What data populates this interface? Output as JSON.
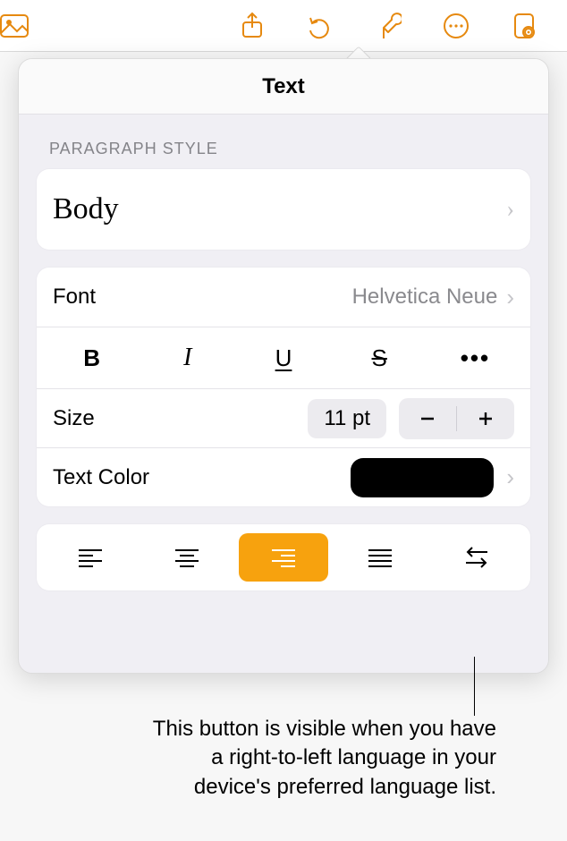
{
  "toolbar": {
    "icons": [
      "media",
      "share",
      "undo",
      "format",
      "more",
      "document"
    ]
  },
  "popover": {
    "title": "Text",
    "paragraph_style_label": "PARAGRAPH STYLE",
    "paragraph_style_value": "Body",
    "font_label": "Font",
    "font_value": "Helvetica Neue",
    "style_buttons": {
      "bold": "B",
      "italic": "I",
      "underline": "U",
      "strike": "S",
      "more": "•••"
    },
    "size_label": "Size",
    "size_value": "11 pt",
    "text_color_label": "Text Color",
    "text_color_value": "#000000",
    "alignment": {
      "options": [
        "left",
        "center",
        "right",
        "justify",
        "rtl"
      ],
      "selected": "right"
    }
  },
  "callout": "This button is visible when you have a right-to-left language in your device's preferred language list."
}
